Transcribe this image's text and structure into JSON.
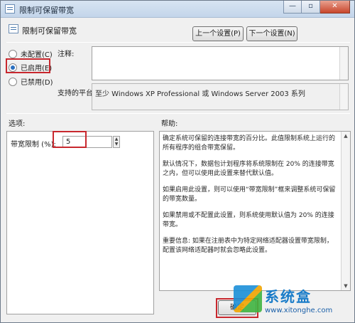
{
  "window": {
    "title": "限制可保留带宽",
    "minimize_glyph": "—",
    "restore_glyph": "▫",
    "close_glyph": "✕"
  },
  "header": {
    "policy_name": "限制可保留带宽",
    "prev_button": "上一个设置(P)",
    "next_button": "下一个设置(N)"
  },
  "state": {
    "options": [
      {
        "label": "未配置(C)",
        "selected": false
      },
      {
        "label": "已启用(E)",
        "selected": true
      },
      {
        "label": "已禁用(D)",
        "selected": false
      }
    ]
  },
  "comment": {
    "label": "注释:",
    "value": ""
  },
  "platform": {
    "label": "支持的平台:",
    "value": "至少 Windows XP Professional 或 Windows Server 2003 系列"
  },
  "options_section": {
    "label": "选项:",
    "bandwidth_label": "带宽限制 (%):",
    "bandwidth_value": "5"
  },
  "help_section": {
    "label": "帮助:",
    "paragraphs": [
      "确定系统可保留的连接带宽的百分比。此值限制系统上运行的所有程序的组合带宽保留。",
      "默认情况下，数据包计划程序将系统限制在 20% 的连接带宽之内，但可以使用此设置来替代默认值。",
      "如果启用此设置，则可以使用“带宽限制”框来调整系统可保留的带宽数量。",
      "如果禁用或不配置此设置，则系统使用默认值为 20% 的连接带宽。",
      "重要信息: 如果在注册表中为特定网络适配器设置带宽限制，配置该网络适配器时就会忽略此设置。"
    ]
  },
  "footer": {
    "ok_button": "确定"
  },
  "watermark": {
    "name": "系统盒",
    "url": "www.xitonghe.com"
  },
  "colors": {
    "highlight_box": "#c8282e",
    "radio_selected": "#2a6fbf"
  }
}
